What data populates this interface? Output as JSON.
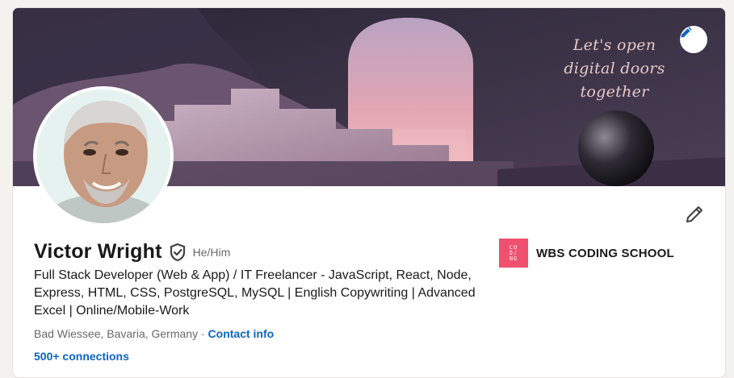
{
  "profile": {
    "name": "Victor Wright",
    "pronouns": "He/Him",
    "headline": "Full Stack Developer (Web & App) / IT Freelancer - JavaScript, React, Node, Express, HTML, CSS, PostgreSQL, MySQL | English Copywriting | Advanced Excel | Online/Mobile-Work",
    "location": "Bad Wiessee, Bavaria, Germany",
    "separator": "·",
    "contact_label": "Contact info",
    "connections": "500+ connections"
  },
  "banner": {
    "lines": [
      "Let's open",
      "digital doors",
      "together"
    ]
  },
  "company": {
    "logo_lines": [
      "CO",
      "D/",
      "NG"
    ],
    "name": "WBS CODING SCHOOL"
  },
  "icons": {
    "edit_banner": "pencil-icon",
    "edit_intro": "pencil-icon",
    "verified": "shield-check-icon"
  },
  "colors": {
    "link": "#0a66c2",
    "company_logo": "#f0506e",
    "banner_text": "#e7c9c9"
  }
}
